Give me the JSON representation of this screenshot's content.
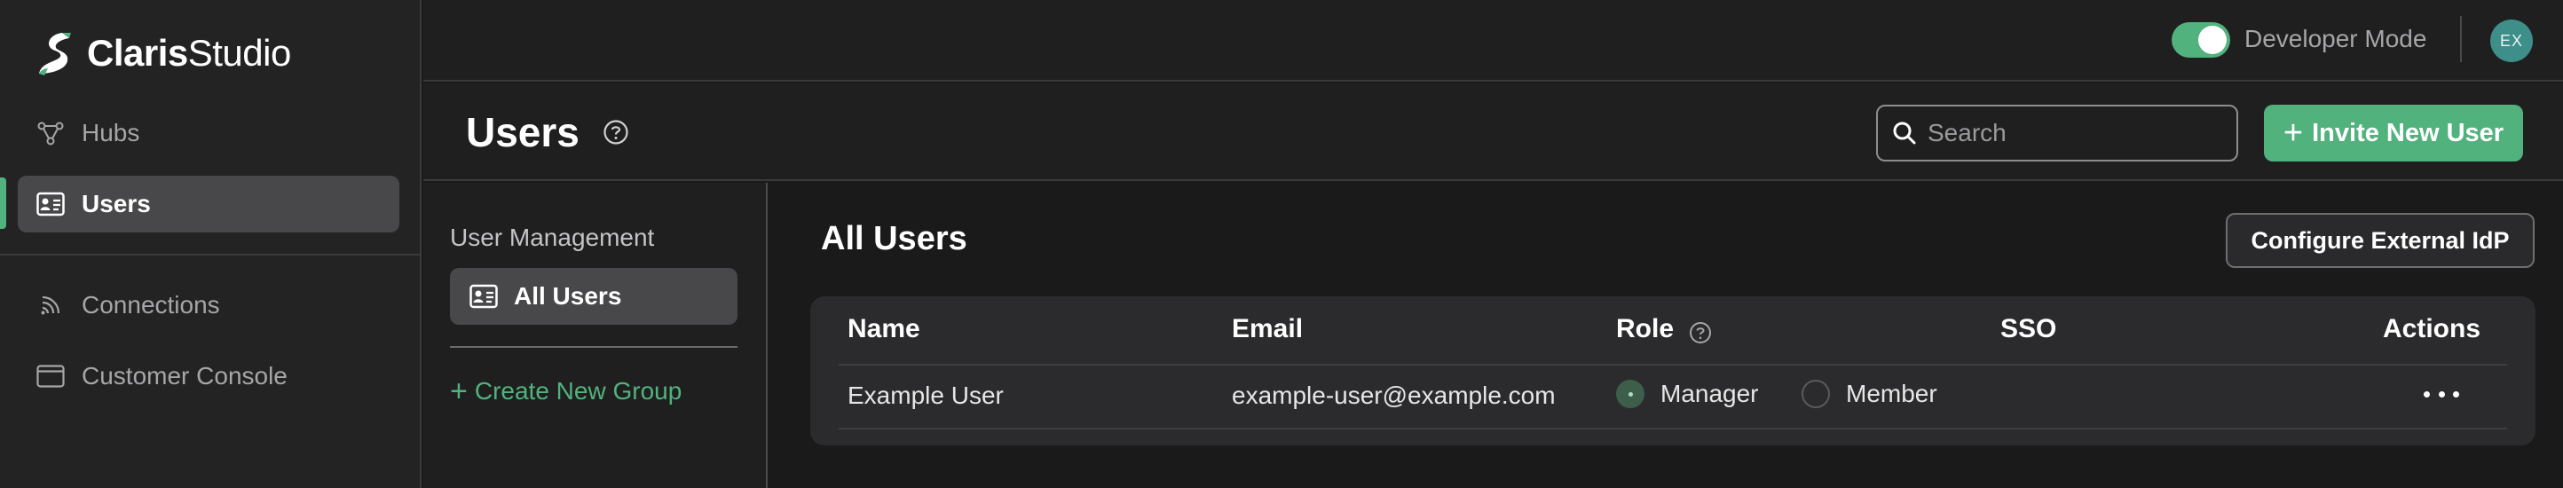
{
  "brand": {
    "name_bold": "Claris",
    "name_light": "Studio"
  },
  "sidebar": {
    "items": [
      {
        "label": "Hubs",
        "icon": "hub-icon"
      },
      {
        "label": "Users",
        "icon": "id-card-icon",
        "active": true
      },
      {
        "label": "Connections",
        "icon": "connections-icon"
      },
      {
        "label": "Customer Console",
        "icon": "window-icon"
      }
    ]
  },
  "topbar": {
    "developer_mode_label": "Developer Mode",
    "developer_mode_on": true,
    "avatar_initials": "EX"
  },
  "header": {
    "title": "Users",
    "search_placeholder": "Search",
    "invite_label": "Invite New User"
  },
  "subnav": {
    "title": "User Management",
    "item_label": "All Users",
    "create_group_label": "Create New Group"
  },
  "main": {
    "section_title": "All Users",
    "idp_button_label": "Configure External IdP",
    "table": {
      "columns": {
        "name": "Name",
        "email": "Email",
        "role": "Role",
        "sso": "SSO",
        "actions": "Actions"
      },
      "rows": [
        {
          "name": "Example User",
          "email": "example-user@example.com",
          "role_options": [
            "Manager",
            "Member"
          ],
          "role_selected": "Manager"
        }
      ]
    }
  },
  "colors": {
    "accent": "#52b27d",
    "avatar": "#3e8e8a",
    "background": "#1a1a1b"
  }
}
